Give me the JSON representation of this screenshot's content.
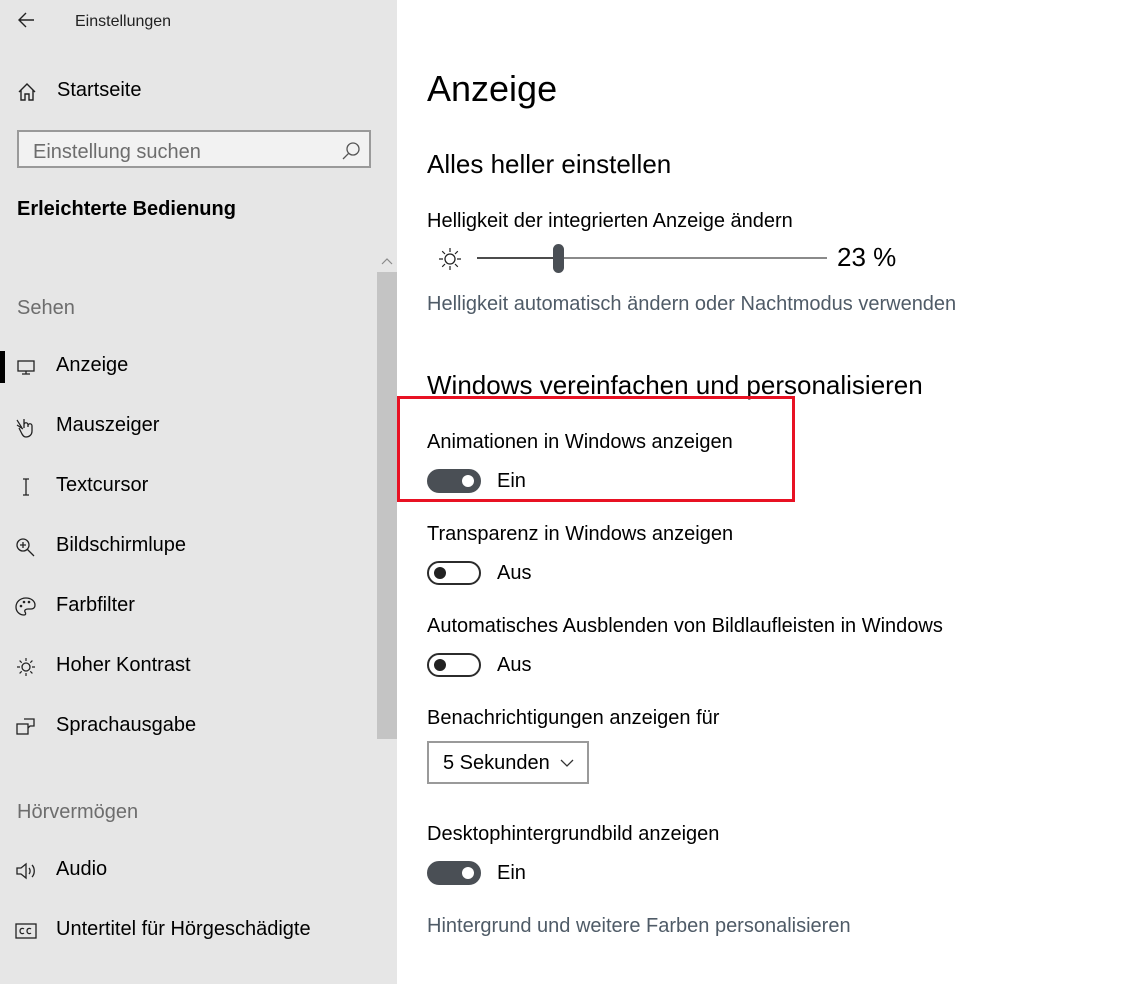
{
  "window": {
    "title": "Einstellungen"
  },
  "sidebar": {
    "home_label": "Startseite",
    "search": {
      "placeholder": "Einstellung suchen"
    },
    "section_title": "Erleichterte Bedienung",
    "groups": [
      {
        "header": "Sehen",
        "items": [
          {
            "label": "Anzeige",
            "icon": "monitor-icon",
            "selected": true
          },
          {
            "label": "Mauszeiger",
            "icon": "mouse-pointer-icon"
          },
          {
            "label": "Textcursor",
            "icon": "text-cursor-icon"
          },
          {
            "label": "Bildschirmlupe",
            "icon": "magnifier-icon"
          },
          {
            "label": "Farbfilter",
            "icon": "palette-icon"
          },
          {
            "label": "Hoher Kontrast",
            "icon": "brightness-icon"
          },
          {
            "label": "Sprachausgabe",
            "icon": "narrator-icon"
          }
        ]
      },
      {
        "header": "Hörvermögen",
        "items": [
          {
            "label": "Audio",
            "icon": "speaker-icon"
          },
          {
            "label": "Untertitel für Hörgeschädigte",
            "icon": "closed-captions-icon"
          }
        ]
      }
    ]
  },
  "main": {
    "title": "Anzeige",
    "brightness": {
      "heading": "Alles heller einstellen",
      "label": "Helligkeit der integrierten Anzeige ändern",
      "value": 23,
      "value_text": "23 %",
      "link": "Helligkeit automatisch ändern oder Nachtmodus verwenden"
    },
    "simplify": {
      "heading": "Windows vereinfachen und personalisieren",
      "animations": {
        "label": "Animationen in Windows anzeigen",
        "state": "on",
        "state_text": "Ein"
      },
      "transparency": {
        "label": "Transparenz in Windows anzeigen",
        "state": "off",
        "state_text": "Aus"
      },
      "scrollbars": {
        "label": "Automatisches Ausblenden von Bildlaufleisten in Windows",
        "state": "off",
        "state_text": "Aus"
      },
      "notifications": {
        "label": "Benachrichtigungen anzeigen für",
        "value": "5 Sekunden"
      },
      "wallpaper": {
        "label": "Desktophintergrundbild anzeigen",
        "state": "on",
        "state_text": "Ein"
      },
      "link": "Hintergrund und weitere Farben personalisieren"
    }
  },
  "highlight_color": "#e81123",
  "toggle_on_color": "#4a4f55"
}
